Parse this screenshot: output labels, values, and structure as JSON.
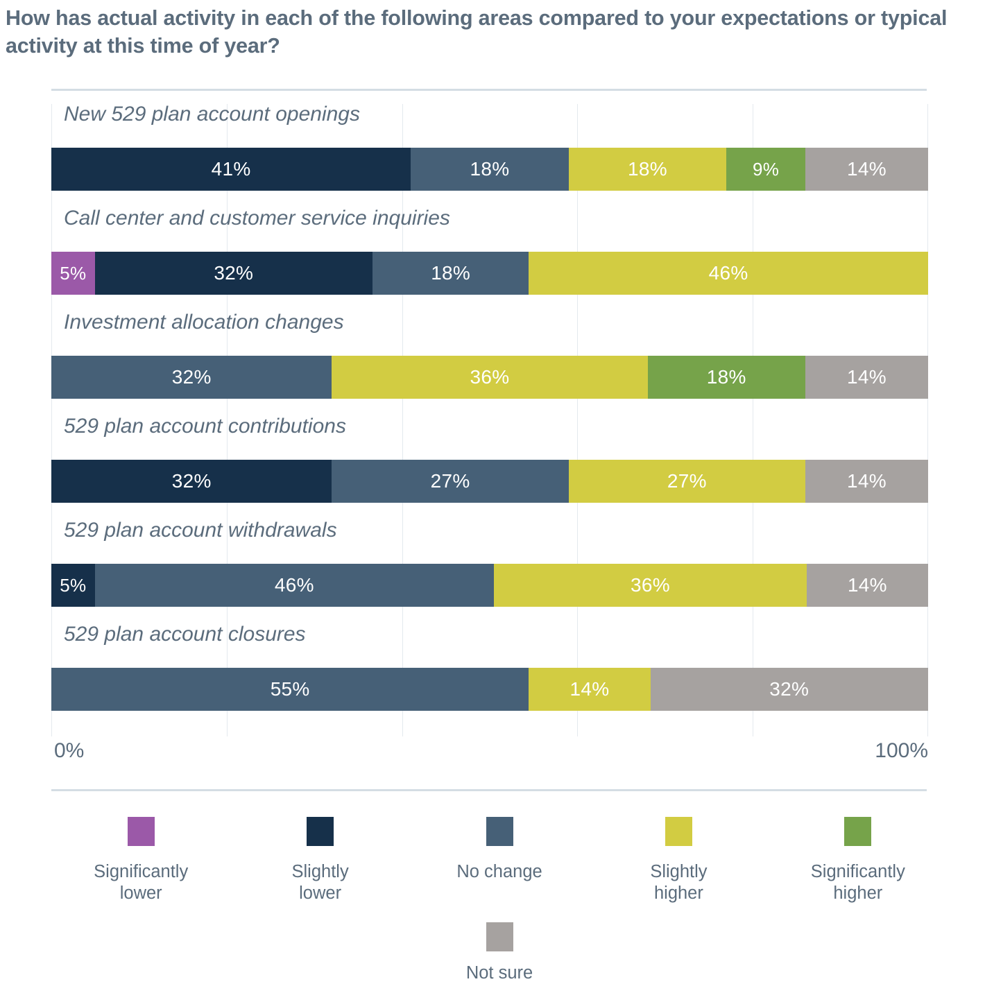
{
  "title": "How has actual activity in each of the following areas compared to your expectations or typical activity at this time of year?",
  "axis": {
    "left_label": "0%",
    "right_label": "100%"
  },
  "legend": {
    "items": [
      {
        "label": "Significantly\nlower",
        "color": "#9B59A8"
      },
      {
        "label": "Slightly\nlower",
        "color": "#16304A"
      },
      {
        "label": "No change",
        "color": "#466077"
      },
      {
        "label": "Slightly\nhigher",
        "color": "#D2CC42"
      },
      {
        "label": "Significantly\nhigher",
        "color": "#76A34A"
      }
    ],
    "not_sure": {
      "label": "Not sure",
      "color": "#A6A2A0"
    }
  },
  "chart_data": {
    "type": "bar",
    "subtype": "stacked-horizontal-100",
    "title": "How has actual activity in each of the following areas compared to your expectations or typical activity at this time of year?",
    "xlabel": "",
    "ylabel": "",
    "xlim": [
      0,
      100
    ],
    "xticks": [
      "0%",
      "100%"
    ],
    "grid": true,
    "legend_position": "bottom",
    "series": [
      {
        "name": "Significantly lower",
        "color": "#9B59A8",
        "values": [
          0,
          5,
          0,
          0,
          0,
          0
        ]
      },
      {
        "name": "Slightly lower",
        "color": "#16304A",
        "values": [
          41,
          32,
          0,
          32,
          5,
          0
        ]
      },
      {
        "name": "No change",
        "color": "#466077",
        "values": [
          18,
          18,
          32,
          27,
          46,
          55
        ]
      },
      {
        "name": "Slightly higher",
        "color": "#D2CC42",
        "values": [
          18,
          46,
          36,
          27,
          36,
          14
        ]
      },
      {
        "name": "Significantly higher",
        "color": "#76A34A",
        "values": [
          9,
          0,
          18,
          0,
          0,
          0
        ]
      },
      {
        "name": "Not sure",
        "color": "#A6A2A0",
        "values": [
          14,
          0,
          14,
          14,
          14,
          32
        ]
      }
    ],
    "categories": [
      "New 529 plan account openings",
      "Call center and customer service inquiries",
      "Investment allocation changes",
      "529 plan account contributions",
      "529 plan account withdrawals",
      "529 plan account closures"
    ],
    "rows": [
      {
        "label": "New 529 plan account openings",
        "segments": [
          {
            "series": "Slightly lower",
            "value": 41,
            "label": "41%",
            "color": "#16304A"
          },
          {
            "series": "No change",
            "value": 18,
            "label": "18%",
            "color": "#466077"
          },
          {
            "series": "Slightly higher",
            "value": 18,
            "label": "18%",
            "color": "#D2CC42"
          },
          {
            "series": "Significantly higher",
            "value": 9,
            "label": "9%",
            "color": "#76A34A"
          },
          {
            "series": "Not sure",
            "value": 14,
            "label": "14%",
            "color": "#A6A2A0"
          }
        ]
      },
      {
        "label": "Call center and customer service inquiries",
        "segments": [
          {
            "series": "Significantly lower",
            "value": 5,
            "label": "5%",
            "color": "#9B59A8"
          },
          {
            "series": "Slightly lower",
            "value": 32,
            "label": "32%",
            "color": "#16304A"
          },
          {
            "series": "No change",
            "value": 18,
            "label": "18%",
            "color": "#466077"
          },
          {
            "series": "Slightly higher",
            "value": 46,
            "label": "46%",
            "color": "#D2CC42"
          }
        ]
      },
      {
        "label": "Investment allocation changes",
        "segments": [
          {
            "series": "No change",
            "value": 32,
            "label": "32%",
            "color": "#466077"
          },
          {
            "series": "Slightly higher",
            "value": 36,
            "label": "36%",
            "color": "#D2CC42"
          },
          {
            "series": "Significantly higher",
            "value": 18,
            "label": "18%",
            "color": "#76A34A"
          },
          {
            "series": "Not sure",
            "value": 14,
            "label": "14%",
            "color": "#A6A2A0"
          }
        ]
      },
      {
        "label": "529 plan account contributions",
        "segments": [
          {
            "series": "Slightly lower",
            "value": 32,
            "label": "32%",
            "color": "#16304A"
          },
          {
            "series": "No change",
            "value": 27,
            "label": "27%",
            "color": "#466077"
          },
          {
            "series": "Slightly higher",
            "value": 27,
            "label": "27%",
            "color": "#D2CC42"
          },
          {
            "series": "Not sure",
            "value": 14,
            "label": "14%",
            "color": "#A6A2A0"
          }
        ]
      },
      {
        "label": "529 plan account withdrawals",
        "segments": [
          {
            "series": "Slightly lower",
            "value": 5,
            "label": "5%",
            "color": "#16304A"
          },
          {
            "series": "No change",
            "value": 46,
            "label": "46%",
            "color": "#466077"
          },
          {
            "series": "Slightly higher",
            "value": 36,
            "label": "36%",
            "color": "#D2CC42"
          },
          {
            "series": "Not sure",
            "value": 14,
            "label": "14%",
            "color": "#A6A2A0"
          }
        ]
      },
      {
        "label": "529 plan account closures",
        "segments": [
          {
            "series": "No change",
            "value": 55,
            "label": "55%",
            "color": "#466077"
          },
          {
            "series": "Slightly higher",
            "value": 14,
            "label": "14%",
            "color": "#D2CC42"
          },
          {
            "series": "Not sure",
            "value": 32,
            "label": "32%",
            "color": "#A6A2A0"
          }
        ]
      }
    ]
  }
}
